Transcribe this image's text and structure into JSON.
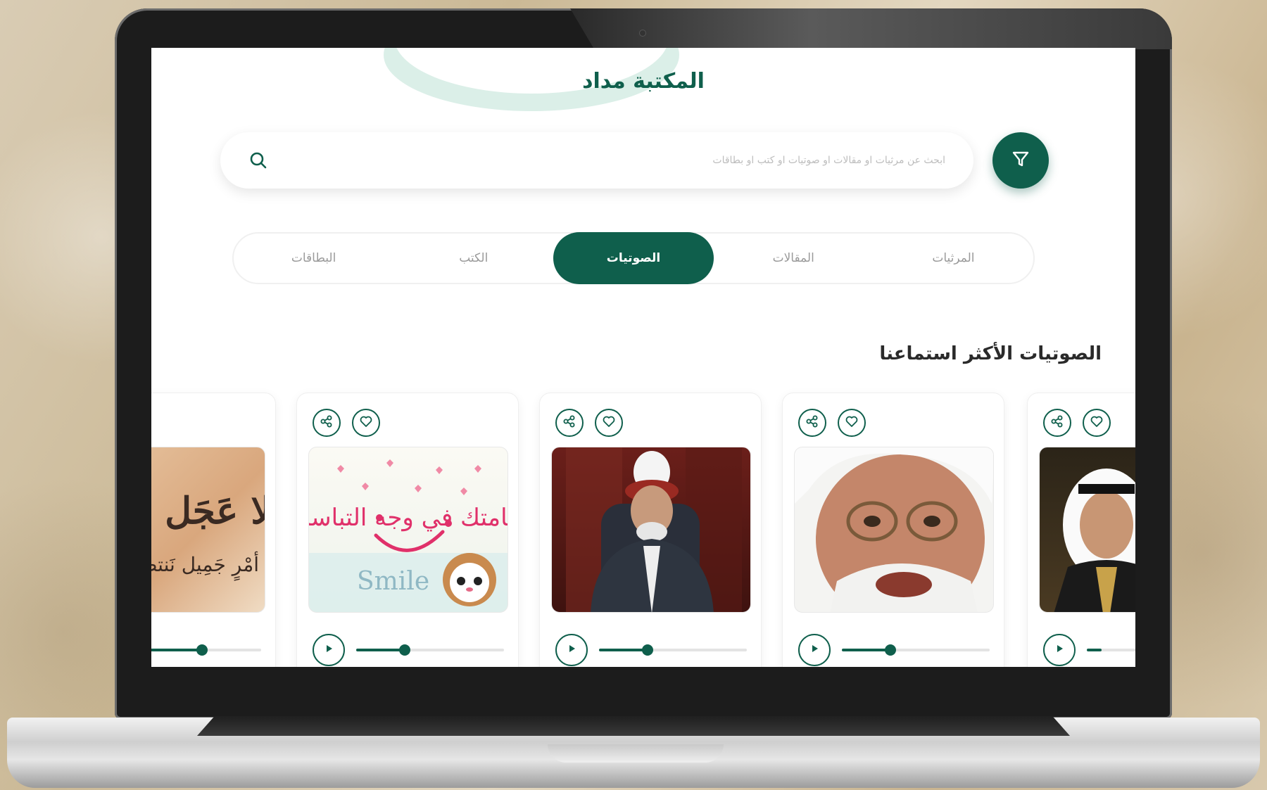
{
  "header": {
    "title": "المكتبة مداد"
  },
  "search": {
    "placeholder": "ابحث عن مرثيات او مقالات او صوتيات او كتب او بطاقات",
    "icon": "search-icon"
  },
  "filter": {
    "icon": "filter-icon"
  },
  "tabs": [
    {
      "label": "المرثيات",
      "active": false
    },
    {
      "label": "المقالات",
      "active": false
    },
    {
      "label": "الصوتيات",
      "active": true
    },
    {
      "label": "الكتب",
      "active": false
    },
    {
      "label": "البطاقات",
      "active": false
    }
  ],
  "section": {
    "title": "الصوتيات الأكثر استماعنا"
  },
  "cards": [
    {
      "thumb": "photo-man-red-keffiyeh",
      "progress": 0.1
    },
    {
      "thumb": "photo-elderly-man-glasses",
      "progress": 0.33
    },
    {
      "thumb": "photo-sheikh-white-turban",
      "progress": 0.33
    },
    {
      "thumb": "illustration-smile",
      "thumb_text": "Smile",
      "thumb_arabic": "ابتسامتك في وجه التباسم نعمة",
      "progress": 0.33
    },
    {
      "thumb": "calligraphy-card",
      "thumb_arabic_1": "لا عَجَل",
      "thumb_arabic_2": "أمْرٍ جَمِيل نَنتظِر",
      "progress": 0.6
    }
  ],
  "colors": {
    "accent": "#0f5f4c",
    "title": "#0f5f4c",
    "text": "#2a2a2a",
    "muted": "#9a9a9a"
  }
}
